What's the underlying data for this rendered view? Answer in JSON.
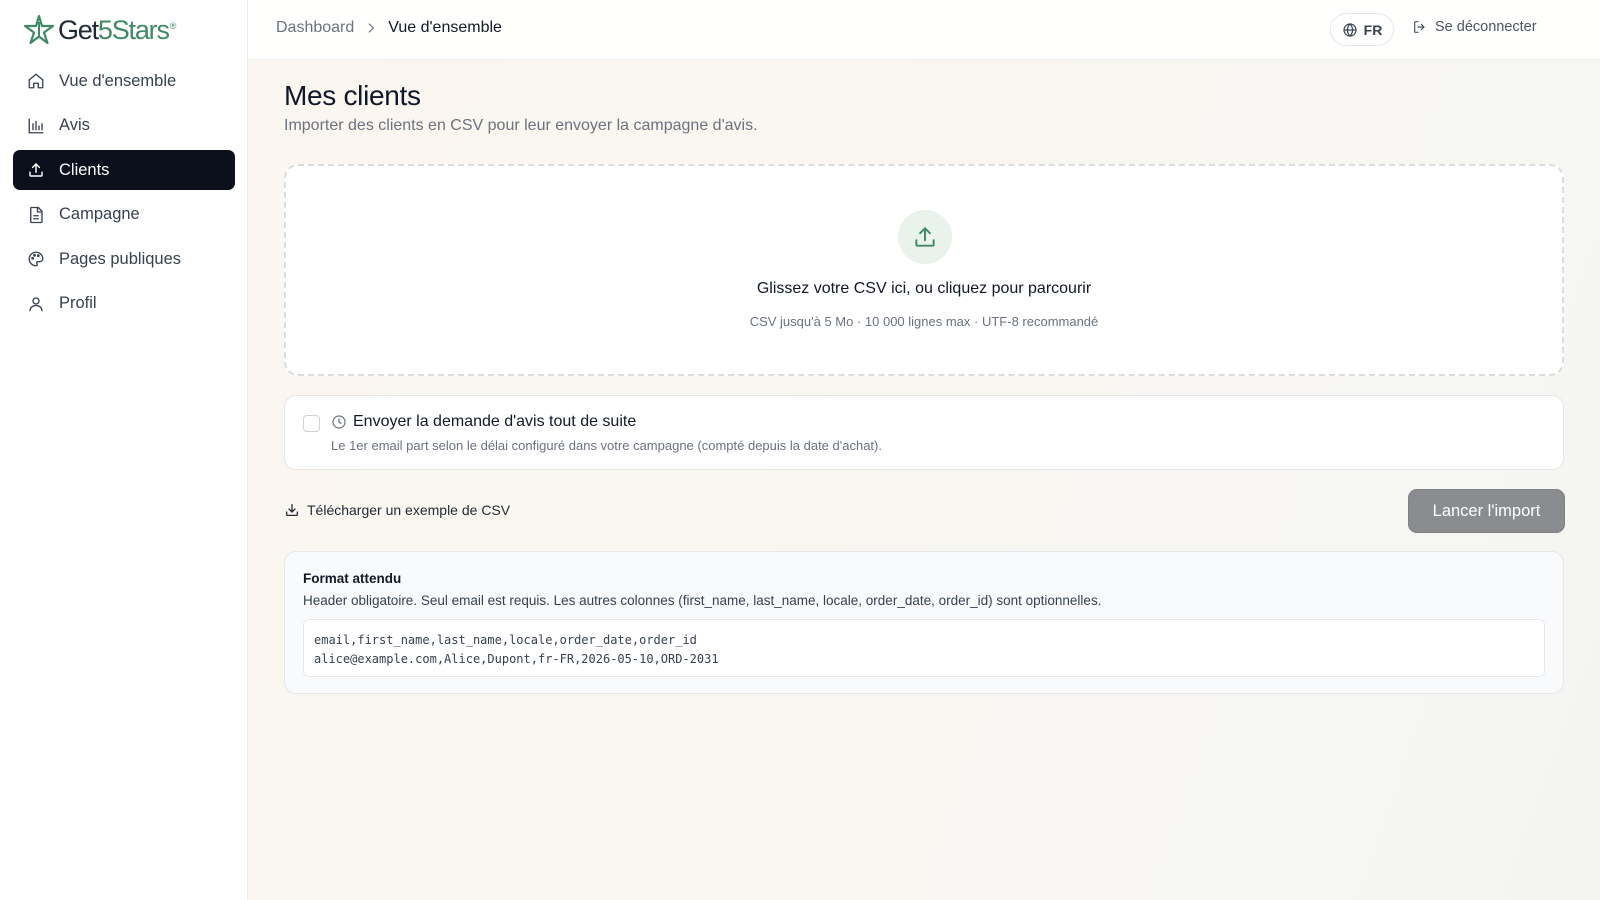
{
  "brand": {
    "name_part1": "Get",
    "name_part2": "5",
    "name_part3": "Stars",
    "registered": "®",
    "accent_color": "#3f8a64"
  },
  "sidebar": {
    "items": [
      {
        "label": "Vue d'ensemble",
        "icon": "home-icon",
        "active": false
      },
      {
        "label": "Avis",
        "icon": "bar-chart-icon",
        "active": false
      },
      {
        "label": "Clients",
        "icon": "upload-icon",
        "active": true
      },
      {
        "label": "Campagne",
        "icon": "document-icon",
        "active": false
      },
      {
        "label": "Pages publiques",
        "icon": "palette-icon",
        "active": false
      },
      {
        "label": "Profil",
        "icon": "user-icon",
        "active": false
      }
    ]
  },
  "topbar": {
    "breadcrumb": {
      "parent": "Dashboard",
      "current": "Vue d'ensemble"
    },
    "language": "FR",
    "logout_label": "Se déconnecter"
  },
  "page": {
    "title": "Mes clients",
    "subtitle": "Importer des clients en CSV pour leur envoyer la campagne d'avis."
  },
  "dropzone": {
    "title": "Glissez votre CSV ici, ou cliquez pour parcourir",
    "hint": "CSV jusqu'à 5 Mo · 10 000 lignes max · UTF-8 recommandé"
  },
  "send_now": {
    "checked": false,
    "title": "Envoyer la demande d'avis tout de suite",
    "description": "Le 1er email part selon le délai configuré dans votre campagne (compté depuis la date d'achat)."
  },
  "actions": {
    "download_sample": "Télécharger un exemple de CSV",
    "import_button": "Lancer l'import"
  },
  "format": {
    "title": "Format attendu",
    "description": "Header obligatoire. Seul email est requis. Les autres colonnes (first_name, last_name, locale, order_date, order_id) sont optionnelles.",
    "code_lines": [
      "email,first_name,last_name,locale,order_date,order_id",
      "alice@example.com,Alice,Dupont,fr-FR,2026-05-10,ORD-2031"
    ]
  }
}
